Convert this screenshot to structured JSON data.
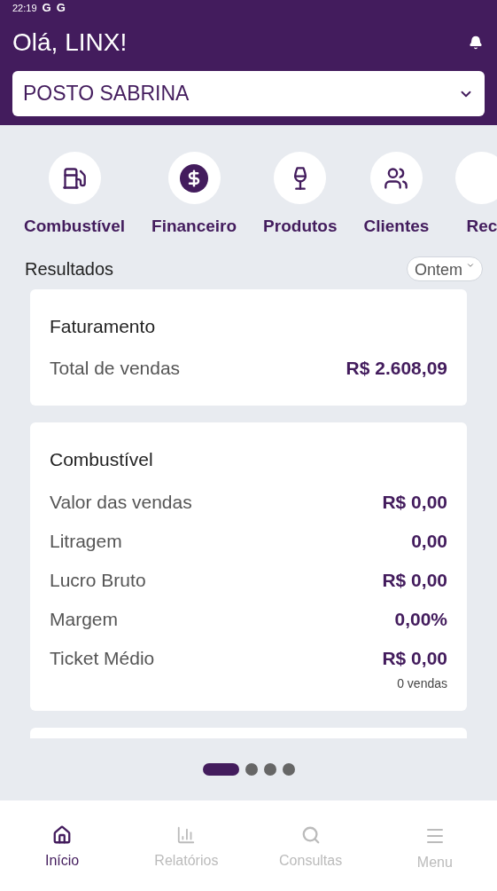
{
  "status_bar": {
    "time": "22:19",
    "notification_letters": [
      "G",
      "G"
    ]
  },
  "header": {
    "greeting": "Olá, LINX!",
    "store_select": {
      "value": "POSTO SABRINA"
    }
  },
  "shortcuts": [
    {
      "kind": "fuel",
      "label": "Combustível"
    },
    {
      "kind": "money",
      "label": "Financeiro"
    },
    {
      "kind": "products",
      "label": "Produtos"
    },
    {
      "kind": "clients",
      "label": "Clientes"
    },
    {
      "kind": "cut",
      "label": "Rec"
    }
  ],
  "results": {
    "title": "Resultados",
    "period_select": {
      "value": "Ontem"
    }
  },
  "cards": [
    {
      "title": "Faturamento",
      "rows": [
        {
          "label": "Total de vendas",
          "value": "R$ 2.608,09"
        }
      ]
    },
    {
      "title": "Combustível",
      "rows": [
        {
          "label": "Valor das vendas",
          "value": "R$ 0,00"
        },
        {
          "label": "Litragem",
          "value": "0,00"
        },
        {
          "label": "Lucro Bruto",
          "value": "R$ 0,00"
        },
        {
          "label": "Margem",
          "value": "0,00%"
        },
        {
          "label": "Ticket Médio",
          "value": "R$ 0,00",
          "note": "0 vendas"
        }
      ]
    },
    {
      "kind": "cut"
    }
  ],
  "pager": [
    {
      "selected": true
    },
    {
      "selected": false
    },
    {
      "selected": false
    },
    {
      "selected": false
    }
  ],
  "bottom_nav": [
    {
      "kind": "home",
      "label": "Início",
      "selected": true
    },
    {
      "kind": "reports",
      "label": "Relatórios",
      "selected": false
    },
    {
      "kind": "search",
      "label": "Consultas",
      "selected": false
    },
    {
      "kind": "menu",
      "label": "Menu",
      "selected": false
    }
  ]
}
